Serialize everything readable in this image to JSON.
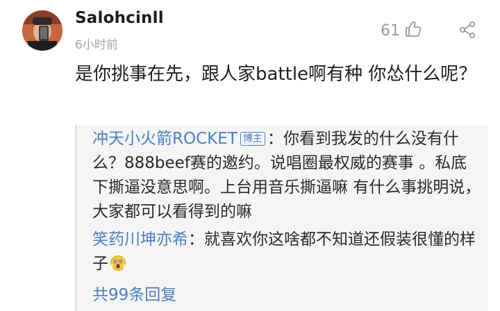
{
  "post": {
    "username": "Salohcinll",
    "timestamp": "6小时前",
    "like_count": "61",
    "text": "是你挑事在先，跟人家battle啊有种 你怂什么呢？"
  },
  "replies": [
    {
      "author": "冲天小火箭ROCKET",
      "badge": "博主",
      "separator": "：",
      "text": "你看到我发的什么没有什么？888beef赛的邀约。说唱圈最权威的赛事 。私底下撕逼没意思啊。上台用音乐撕逼嘛 有什么事挑明说，大家都可以看得到的嘛"
    },
    {
      "author": "笑药川坤亦希",
      "separator": "：",
      "text": "就喜欢你这啥都不知道还假装很懂的样子",
      "emoji": "scared-face-emoji"
    }
  ],
  "view_all_replies": "共99条回复",
  "icons": {
    "like": "thumbs-up-icon",
    "share": "share-icon"
  },
  "colors": {
    "link_blue": "#4a7fc1",
    "muted_gray": "#a3a3a3",
    "reply_bg": "#f5f5f5"
  }
}
